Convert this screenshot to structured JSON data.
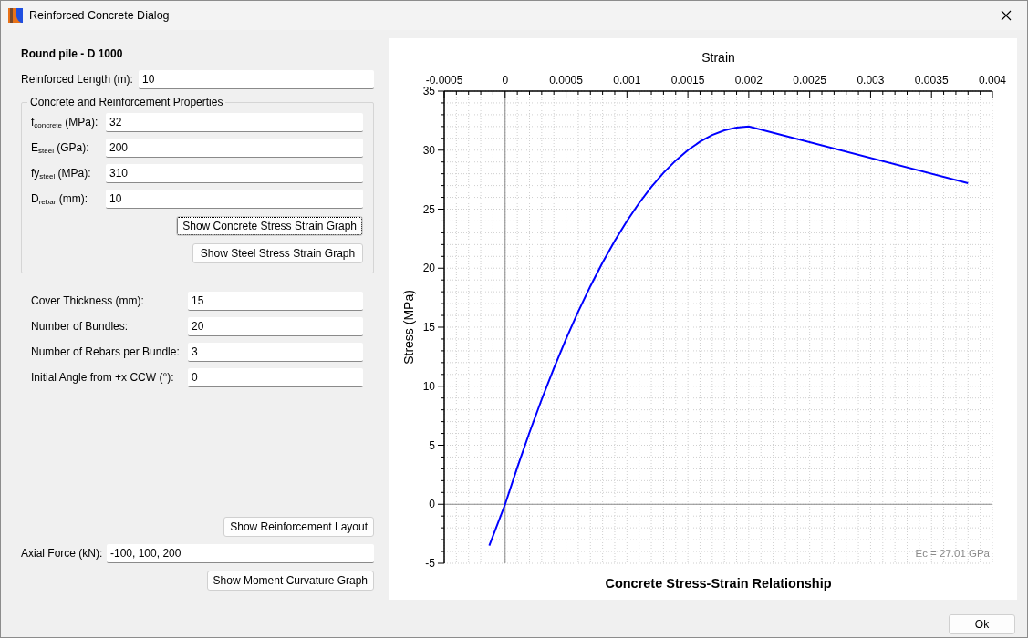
{
  "window": {
    "title": "Reinforced Concrete Dialog"
  },
  "heading": "Round pile - D 1000",
  "length_field": {
    "label": "Reinforced Length (m):",
    "value": "10"
  },
  "properties_group": {
    "title": "Concrete and Reinforcement Properties",
    "fields": [
      {
        "label": "f$_{concrete}$ (MPa):",
        "value": "32"
      },
      {
        "label": "E$_{steel}$ (GPa):",
        "value": "200"
      },
      {
        "label": "fy$_{steel}$ (MPa):",
        "value": "310"
      },
      {
        "label": "D$_{rebar}$ (mm):",
        "value": "10"
      }
    ],
    "buttons": [
      {
        "label": "Show Concrete Stress Strain Graph",
        "focused": true
      },
      {
        "label": "Show Steel Stress Strain Graph",
        "focused": false
      }
    ]
  },
  "bundle_fields": [
    {
      "label": "Cover Thickness (mm):",
      "value": "15"
    },
    {
      "label": "Number of Bundles:",
      "value": "20"
    },
    {
      "label": "Number of Rebars per Bundle:",
      "value": "3"
    },
    {
      "label": "Initial Angle from +x CCW (°):",
      "value": "0"
    }
  ],
  "layout_button": "Show Reinforcement Layout",
  "axial_field": {
    "label": "Axial Force (kN):",
    "value": "-100, 100, 200"
  },
  "moment_button": "Show Moment Curvature Graph",
  "chart": {
    "chart_data": {
      "type": "line",
      "title": "Concrete Stress-Strain Relationship",
      "xlabel": "Strain",
      "ylabel": "Stress (MPa)",
      "x": [
        -0.00013,
        0,
        0.0001,
        0.0002,
        0.0003,
        0.0004,
        0.0005,
        0.0006,
        0.0007,
        0.0008,
        0.0009,
        0.001,
        0.0011,
        0.0012,
        0.0013,
        0.0014,
        0.0015,
        0.0016,
        0.0017,
        0.0018,
        0.0019,
        0.002,
        0.0038
      ],
      "series": [
        {
          "color": "#0000ff",
          "values": [
            -3.5,
            0,
            3.12,
            6.08,
            8.88,
            11.52,
            14,
            16.32,
            18.48,
            20.48,
            22.32,
            24,
            25.52,
            26.88,
            28.08,
            29.12,
            30,
            30.72,
            31.28,
            31.68,
            31.92,
            32,
            27.2
          ]
        }
      ],
      "grid": true,
      "xlim": [
        -0.0005,
        0.004
      ],
      "ylim": [
        -5,
        35
      ],
      "xticks": [
        -0.0005,
        0,
        0.0005,
        0.001,
        0.0015,
        0.002,
        0.0025,
        0.003,
        0.0035,
        0.004
      ],
      "yticks": [
        -5,
        0,
        5,
        10,
        15,
        20,
        25,
        30,
        35
      ],
      "annotations": [
        "Ec = 27.01 GPa"
      ]
    }
  },
  "ok_button": "Ok"
}
